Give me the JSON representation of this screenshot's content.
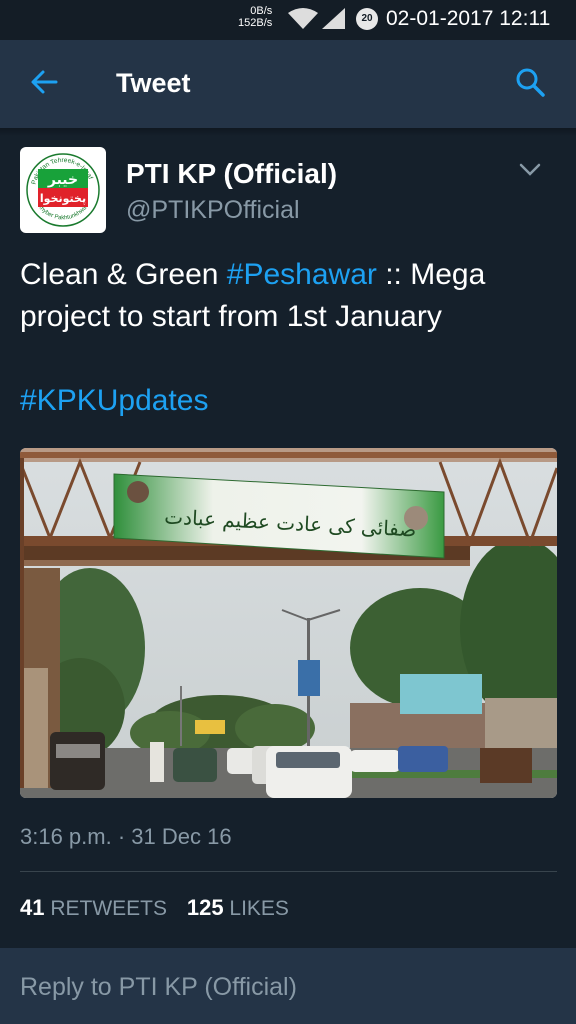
{
  "status": {
    "net_down": "0B/s",
    "net_up": "152B/s",
    "battery": "20",
    "datetime": "02-01-2017 12:11"
  },
  "appbar": {
    "title": "Tweet"
  },
  "tweet": {
    "name": "PTI KP (Official)",
    "handle": "@PTIKPOfficial",
    "text_1": "Clean & Green ",
    "hashtag_1": "#Peshawar",
    "text_2": " :: Mega project to start from 1st January",
    "hashtag_2": "#KPKUpdates",
    "time": "3:16 p.m. · 31 Dec 16",
    "retweets": "41",
    "retweets_label": "RETWEETS",
    "likes": "125",
    "likes_label": "LIKES"
  },
  "logo": {
    "top_text": "Pakistan Tehreek-e-Insaf",
    "bottom_text": "Khyber Pakhtunkhwa",
    "urdu_top": "خیبر",
    "urdu_bottom": "پختونخوا"
  },
  "banner": {
    "urdu_text": "صفائی کی عادت عظیم عبادت"
  },
  "reply": {
    "placeholder": "Reply to PTI KP (Official)"
  },
  "colors": {
    "background": "#15202b",
    "appbar": "#243447",
    "accent": "#1da1f2",
    "muted": "#8899a6"
  }
}
